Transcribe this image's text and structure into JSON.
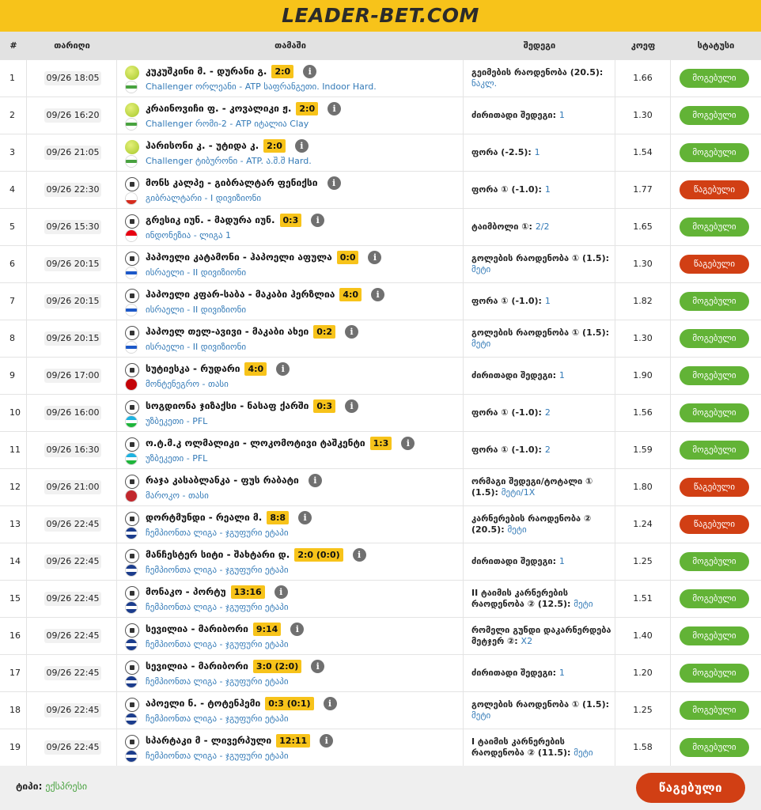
{
  "brand": {
    "logo_text": "LEADER-BET.COM"
  },
  "headers": {
    "num": "#",
    "date": "თარიღი",
    "match": "თამაში",
    "result": "შედეგი",
    "coef": "კოეფ",
    "status": "სტატუსი"
  },
  "colors": {
    "won": "#62b336",
    "lost": "#d13f14",
    "accent": "#f7c31a"
  },
  "rows": [
    {
      "num": "1",
      "date": "09/26 18:05",
      "sport": "tennis-ball-icon",
      "flag": "world",
      "teams": "კუკუშკინი მ. - დურანი გ.",
      "score": "2:0",
      "league": "Challenger ორლეანი - ATP საფრანგეთი. Indoor Hard.",
      "result": "გეიმების რაოდენობა (20.5):",
      "result_value": "ნაკლ.",
      "coef": "1.66",
      "status": "მოგებული",
      "won": true
    },
    {
      "num": "2",
      "date": "09/26 16:20",
      "sport": "tennis-ball-icon",
      "flag": "world",
      "teams": "კრაინოვიჩი ფ. - კოვალიკი ჟ.",
      "score": "2:0",
      "league": "Challenger რომი-2 - ATP იტალია Clay",
      "result": "ძირითადი შედეგი:",
      "result_value": "1",
      "coef": "1.30",
      "status": "მოგებული",
      "won": true
    },
    {
      "num": "3",
      "date": "09/26 21:05",
      "sport": "tennis-ball-icon",
      "flag": "world",
      "teams": "ჰარისონი კ. - უტიდა კ.",
      "score": "2:0",
      "league": "Challenger ტიბურონი - ATP. ა.შ.შ Hard.",
      "result": "ფორა (-2.5):",
      "result_value": "1",
      "coef": "1.54",
      "status": "მოგებული",
      "won": true
    },
    {
      "num": "4",
      "date": "09/26 22:30",
      "sport": "football-icon",
      "flag": "gibraltar",
      "teams": "მონს კალპე - გიბრალტარ ფენიქსი",
      "score": "",
      "league": "გიბრალტარი - I დივიზიონი",
      "result": "ფორა ① (-1.0):",
      "result_value": "1",
      "coef": "1.77",
      "status": "წაგებული",
      "won": false
    },
    {
      "num": "5",
      "date": "09/26 15:30",
      "sport": "football-icon",
      "flag": "indonesia",
      "teams": "გრესიკ იუნ. - მადურა იუნ.",
      "score": "0:3",
      "league": "ინდონეზია - ლიგა 1",
      "result": "ტაიმბოლი ①:",
      "result_value": "2/2",
      "coef": "1.65",
      "status": "მოგებული",
      "won": true
    },
    {
      "num": "6",
      "date": "09/26 20:15",
      "sport": "football-icon",
      "flag": "israel",
      "teams": "ჰაპოელი კატამონი - ჰაპოელი აფულა",
      "score": "0:0",
      "league": "ისრაელი - II დივიზიონი",
      "result": "გოლების რაოდენობა ① (1.5):",
      "result_value": "მეტი",
      "coef": "1.30",
      "status": "წაგებული",
      "won": false
    },
    {
      "num": "7",
      "date": "09/26 20:15",
      "sport": "football-icon",
      "flag": "israel",
      "teams": "ჰაპოელი კფარ-საბა - მაკაბი ჰერზლია",
      "score": "4:0",
      "league": "ისრაელი - II დივიზიონი",
      "result": "ფორა ① (-1.0):",
      "result_value": "1",
      "coef": "1.82",
      "status": "მოგებული",
      "won": true
    },
    {
      "num": "8",
      "date": "09/26 20:15",
      "sport": "football-icon",
      "flag": "israel",
      "teams": "ჰაპოელ თელ-ავივი - მაკაბი ახეი",
      "score": "0:2",
      "league": "ისრაელი - II დივიზიონი",
      "result": "გოლების რაოდენობა ① (1.5):",
      "result_value": "მეტი",
      "coef": "1.30",
      "status": "მოგებული",
      "won": true
    },
    {
      "num": "9",
      "date": "09/26 17:00",
      "sport": "football-icon",
      "flag": "montenegro",
      "teams": "სუტიესკა - რუდარი",
      "score": "4:0",
      "league": "მონტენეგრო - თასი",
      "result": "ძირითადი შედეგი:",
      "result_value": "1",
      "coef": "1.90",
      "status": "მოგებული",
      "won": true
    },
    {
      "num": "10",
      "date": "09/26 16:00",
      "sport": "football-icon",
      "flag": "uzbekistan",
      "teams": "სოგდიონა ჯიზაქსი - ნასაფ ქარში",
      "score": "0:3",
      "league": "უზბეკეთი - PFL",
      "result": "ფორა ① (-1.0):",
      "result_value": "2",
      "coef": "1.56",
      "status": "მოგებული",
      "won": true
    },
    {
      "num": "11",
      "date": "09/26 16:30",
      "sport": "football-icon",
      "flag": "uzbekistan",
      "teams": "ო.ტ.მ.კ ოლმალიკი - ლოკომოტივი ტაშკენტი",
      "score": "1:3",
      "league": "უზბეკეთი - PFL",
      "result": "ფორა ① (-1.0):",
      "result_value": "2",
      "coef": "1.59",
      "status": "მოგებული",
      "won": true
    },
    {
      "num": "12",
      "date": "09/26 21:00",
      "sport": "football-icon",
      "flag": "morocco",
      "teams": "რაჯა კასაბლანკა - ფუს რაბატი",
      "score": "",
      "league": "მაროკო - თასი",
      "result": "ორმაგი შედეგი/ტოტალი ① (1.5):",
      "result_value": "მეტი/1X",
      "coef": "1.80",
      "status": "წაგებული",
      "won": false
    },
    {
      "num": "13",
      "date": "09/26 22:45",
      "sport": "football-icon",
      "flag": "ucl",
      "teams": "დორტმუნდი - რეალი მ.",
      "score": "8:8",
      "league": "ჩემპიონთა ლიგა - ჯგუფური ეტაპი",
      "result": "კარნერების რაოდენობა ② (20.5):",
      "result_value": "მეტი",
      "coef": "1.24",
      "status": "წაგებული",
      "won": false
    },
    {
      "num": "14",
      "date": "09/26 22:45",
      "sport": "football-icon",
      "flag": "ucl",
      "teams": "მანჩესტერ სიტი - შახტარი დ.",
      "score": "2:0 (0:0)",
      "league": "ჩემპიონთა ლიგა - ჯგუფური ეტაპი",
      "result": "ძირითადი შედეგი:",
      "result_value": "1",
      "coef": "1.25",
      "status": "მოგებული",
      "won": true
    },
    {
      "num": "15",
      "date": "09/26 22:45",
      "sport": "football-icon",
      "flag": "ucl",
      "teams": "მონაკო - პორტუ",
      "score": "13:16",
      "league": "ჩემპიონთა ლიგა - ჯგუფური ეტაპი",
      "result": "II ტაიმის კარნერების რაოდენობა ② (12.5):",
      "result_value": "მეტი",
      "coef": "1.51",
      "status": "მოგებული",
      "won": true
    },
    {
      "num": "16",
      "date": "09/26 22:45",
      "sport": "football-icon",
      "flag": "ucl",
      "teams": "სევილია - მარიბორი",
      "score": "9:14",
      "league": "ჩემპიონთა ლიგა - ჯგუფური ეტაპი",
      "result": "რომელი გუნდი დაკარნერდება მეტჯერ ②:",
      "result_value": "X2",
      "coef": "1.40",
      "status": "მოგებული",
      "won": true
    },
    {
      "num": "17",
      "date": "09/26 22:45",
      "sport": "football-icon",
      "flag": "ucl",
      "teams": "სევილია - მარიბორი",
      "score": "3:0 (2:0)",
      "league": "ჩემპიონთა ლიგა - ჯგუფური ეტაპი",
      "result": "ძირითადი შედეგი:",
      "result_value": "1",
      "coef": "1.20",
      "status": "მოგებული",
      "won": true
    },
    {
      "num": "18",
      "date": "09/26 22:45",
      "sport": "football-icon",
      "flag": "ucl",
      "teams": "აპოელი ნ. - ტოტენჰემი",
      "score": "0:3 (0:1)",
      "league": "ჩემპიონთა ლიგა - ჯგუფური ეტაპი",
      "result": "გოლების რაოდენობა ① (1.5):",
      "result_value": "მეტი",
      "coef": "1.25",
      "status": "მოგებული",
      "won": true
    },
    {
      "num": "19",
      "date": "09/26 22:45",
      "sport": "football-icon",
      "flag": "ucl",
      "teams": "სპარტაკი მ - ლივერპული",
      "score": "12:11",
      "league": "ჩემპიონთა ლიგა - ჯგუფური ეტაპი",
      "result": "I ტაიმის კარნერების რაოდენობა ② (11.5):",
      "result_value": "მეტი",
      "coef": "1.58",
      "status": "მოგებული",
      "won": true
    }
  ],
  "footer": {
    "type_label": "ტიპი:",
    "type_value": "ექსპრესი",
    "overall_status": "წაგებული",
    "overall_won": false
  }
}
